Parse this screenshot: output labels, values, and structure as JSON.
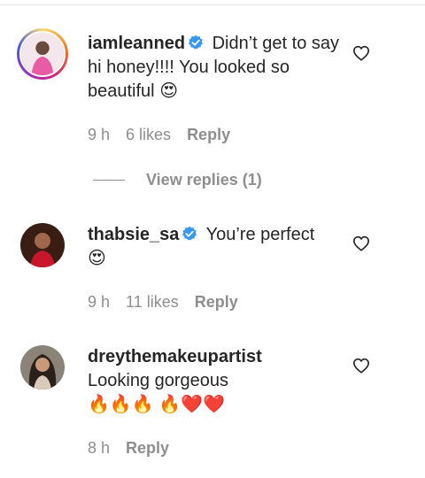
{
  "comments": [
    {
      "username": "iamleanned",
      "verified": true,
      "text": "Didn’t get to say hi honey!!!! You looked so beautiful",
      "emoji": "😍",
      "time": "9 h",
      "likes": "6 likes",
      "reply_label": "Reply",
      "avatar_icon": "avatar-pink-outfit",
      "story_ring": true
    },
    {
      "username": "thabsie_sa",
      "verified": true,
      "text": "You’re perfect",
      "emoji": "😍",
      "time": "9 h",
      "likes": "11 likes",
      "reply_label": "Reply",
      "avatar_icon": "avatar-red-dress",
      "story_ring": false
    },
    {
      "username": "dreythemakeupartist",
      "verified": false,
      "text": "Looking gorgeous",
      "emoji": "🔥🔥🔥 🔥❤️❤️",
      "time": "8 h",
      "reply_label": "Reply",
      "avatar_icon": "avatar-long-hair",
      "story_ring": false
    }
  ],
  "view_replies": "View replies (1)",
  "icons": {
    "like": "heart-outline-icon",
    "verified": "verified-badge-icon"
  },
  "colors": {
    "verified": "#3897f0",
    "meta": "#8e8e8e",
    "text": "#262626"
  }
}
